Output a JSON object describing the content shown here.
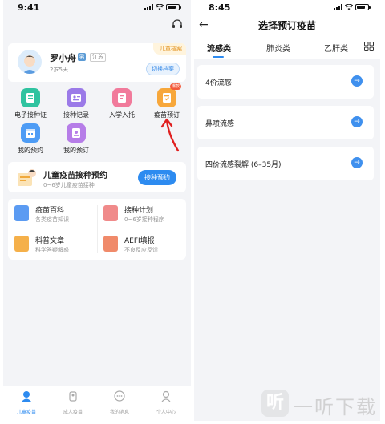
{
  "left": {
    "status_time": "9:41",
    "profile": {
      "name": "罗小舟",
      "badge": "男",
      "region": "江苏",
      "age": "2岁5天",
      "tag": "儿童档案",
      "switch_label": "切换档案"
    },
    "grid": [
      {
        "label": "电子接种证",
        "icon": "certificate-icon",
        "color": "#2fc3a0"
      },
      {
        "label": "接种记录",
        "icon": "record-icon",
        "color": "#9b7ae8"
      },
      {
        "label": "入学入托",
        "icon": "school-icon",
        "color": "#f17a9b"
      },
      {
        "label": "疫苗预订",
        "icon": "vaccine-booking-icon",
        "color": "#f7a73b",
        "hot": "爆款"
      },
      {
        "label": "我的预约",
        "icon": "my-appointment-icon",
        "color": "#4e9cf5"
      },
      {
        "label": "我的预订",
        "icon": "my-booking-icon",
        "color": "#b67de8"
      }
    ],
    "banner": {
      "title": "儿童疫苗接种预约",
      "subtitle": "0~6岁儿童疫苗接种",
      "button": "接种预约"
    },
    "cards": [
      {
        "title": "疫苗百科",
        "subtitle": "各类疫苗知识",
        "color": "#5b9bf2"
      },
      {
        "title": "接种计划",
        "subtitle": "0~6岁接种程序",
        "color": "#f08a8a"
      },
      {
        "title": "科普文章",
        "subtitle": "科学答疑解惑",
        "color": "#f5b04a"
      },
      {
        "title": "AEFI填报",
        "subtitle": "不良反应反馈",
        "color": "#f08a6a"
      }
    ],
    "tabbar": [
      {
        "label": "儿童疫苗",
        "icon": "child-vaccine-icon",
        "active": true
      },
      {
        "label": "成人疫苗",
        "icon": "adult-vaccine-icon",
        "active": false
      },
      {
        "label": "我的消息",
        "icon": "message-icon",
        "active": false
      },
      {
        "label": "个人中心",
        "icon": "profile-icon",
        "active": false
      }
    ]
  },
  "right": {
    "status_time": "8:45",
    "title": "选择预订疫苗",
    "tabs": [
      "流感类",
      "肺炎类",
      "乙肝类"
    ],
    "vaccines": [
      "4价流感",
      "鼻喷流感",
      "四价流感裂解 (6–35月)"
    ]
  },
  "watermark": {
    "logo": "听",
    "text": "一听下载"
  },
  "colors": {
    "accent": "#2d8bf0",
    "annotation_arrow": "#e02020"
  }
}
